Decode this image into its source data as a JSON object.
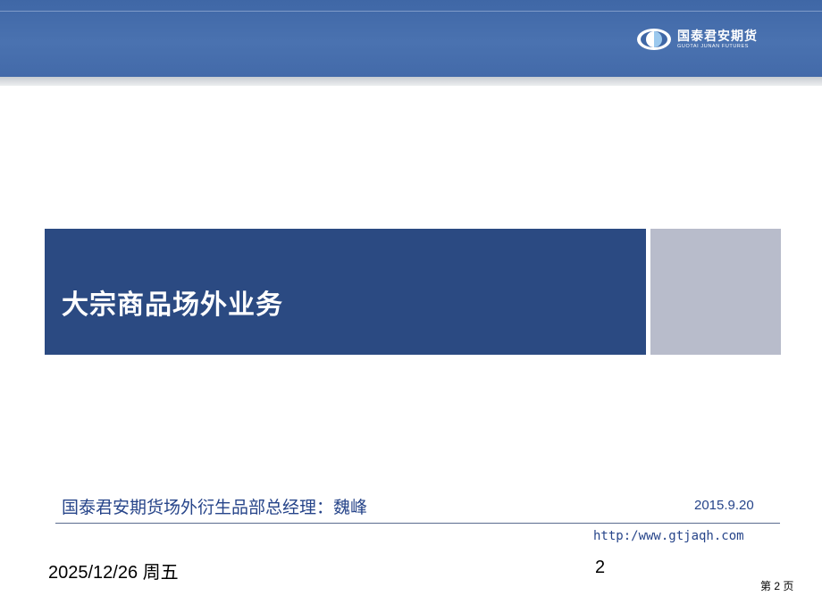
{
  "header": {
    "logo": {
      "name_cn": "国泰君安期货",
      "name_en": "GUOTAI JUNAN FUTURES",
      "icon": "guotai-junan-logo-icon"
    }
  },
  "title": "大宗商品场外业务",
  "subtitle": "国泰君安期货场外衍生品部总经理：魏峰",
  "date": "2015.9.20",
  "url": "http:/www.gtjaqh.com",
  "footer": {
    "date": "2025/12/26 周五",
    "slide_number": "2",
    "page_label": "第 2 页"
  },
  "colors": {
    "banner": "#4a72b0",
    "title_block": "#2b4a82",
    "side_block": "#b8bccb",
    "text_blue": "#27458a"
  }
}
